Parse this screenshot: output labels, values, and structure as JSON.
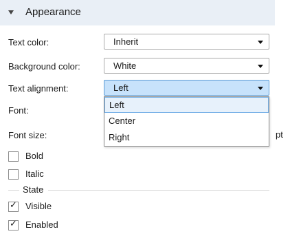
{
  "section": {
    "title": "Appearance",
    "caret_icon": "caret-down-icon"
  },
  "fields": {
    "text_color": {
      "label": "Text color:",
      "value": "Inherit"
    },
    "background_color": {
      "label": "Background color:",
      "value": "White"
    },
    "text_alignment": {
      "label": "Text alignment:",
      "value": "Left",
      "options": [
        "Left",
        "Center",
        "Right"
      ]
    },
    "font": {
      "label": "Font:"
    },
    "font_size": {
      "label": "Font size:",
      "unit": "pt"
    }
  },
  "checkboxes": {
    "bold": {
      "label": "Bold",
      "checked": false
    },
    "italic": {
      "label": "Italic",
      "checked": false
    }
  },
  "state_group": {
    "title": "State",
    "visible": {
      "label": "Visible",
      "checked": true
    },
    "enabled": {
      "label": "Enabled",
      "checked": true
    }
  },
  "check_glyph": "✓",
  "colors": {
    "header_bg": "#e9eff6",
    "active_combo_bg": "#c7e2fb",
    "selected_option_bg": "#e7f1fb"
  }
}
